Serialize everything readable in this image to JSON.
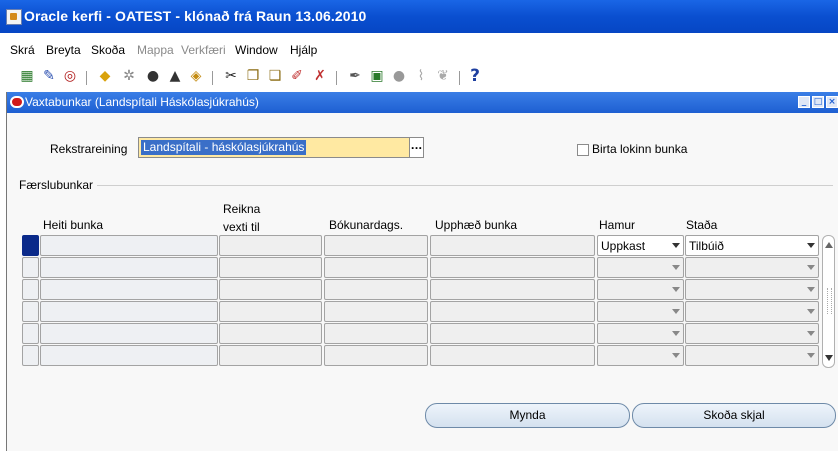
{
  "window": {
    "title": "Oracle kerfi - OATEST - klónað frá Raun 13.06.2010"
  },
  "menu": [
    {
      "label": "Skrá",
      "enabled": true
    },
    {
      "label": "Breyta",
      "enabled": true
    },
    {
      "label": "Skoða",
      "enabled": true
    },
    {
      "label": "Mappa",
      "enabled": false
    },
    {
      "label": "Verkfæri",
      "enabled": false
    },
    {
      "label": "Window",
      "enabled": true
    },
    {
      "label": "Hjálp",
      "enabled": true
    }
  ],
  "toolbar": {
    "icons": [
      "new-record-icon",
      "find-icon",
      "navigator-icon",
      "open-folder-icon",
      "save-icon",
      "print-icon",
      "switch-responsibility-icon",
      "cut-icon",
      "copy-icon",
      "paste-icon",
      "clear-record-icon",
      "delete-record-icon",
      "edit-field-icon",
      "zoom-icon",
      "translations-icon",
      "attachments-icon",
      "folder-tools-icon",
      "help-icon"
    ]
  },
  "form": {
    "title": "Vaxtabunkar (Landspítali Háskólasjúkrahús)",
    "org_label": "Rekstrareining",
    "org_value": "Landspítali - háskólasjúkrahús",
    "lov_button": "...",
    "show_closed_label": "Birta lokinn bunka",
    "show_closed_checked": false,
    "section_label": "Færslubunkar",
    "columns": {
      "name": "Heiti bunka",
      "calc_interest": "Reikna\nvexti til",
      "accounting_date": "Bókunardags.",
      "amount": "Upphæð bunka",
      "mode": "Hamur",
      "status": "Staða"
    },
    "rows": [
      {
        "name": "",
        "calc_interest": "",
        "accounting_date": "",
        "amount": "",
        "mode": "Uppkast",
        "status": "Tilbúið"
      },
      {
        "name": "",
        "calc_interest": "",
        "accounting_date": "",
        "amount": "",
        "mode": "",
        "status": ""
      },
      {
        "name": "",
        "calc_interest": "",
        "accounting_date": "",
        "amount": "",
        "mode": "",
        "status": ""
      },
      {
        "name": "",
        "calc_interest": "",
        "accounting_date": "",
        "amount": "",
        "mode": "",
        "status": ""
      },
      {
        "name": "",
        "calc_interest": "",
        "accounting_date": "",
        "amount": "",
        "mode": "",
        "status": ""
      },
      {
        "name": "",
        "calc_interest": "",
        "accounting_date": "",
        "amount": "",
        "mode": "",
        "status": ""
      }
    ],
    "buttons": {
      "create": "Mynda",
      "view_document": "Skoða skjal"
    }
  },
  "colors": {
    "title_bar": "#0a4fd0",
    "form_title_bar": "#1e5fd2",
    "required_field": "#ffe9a2",
    "current_record": "#0b2a8a"
  }
}
